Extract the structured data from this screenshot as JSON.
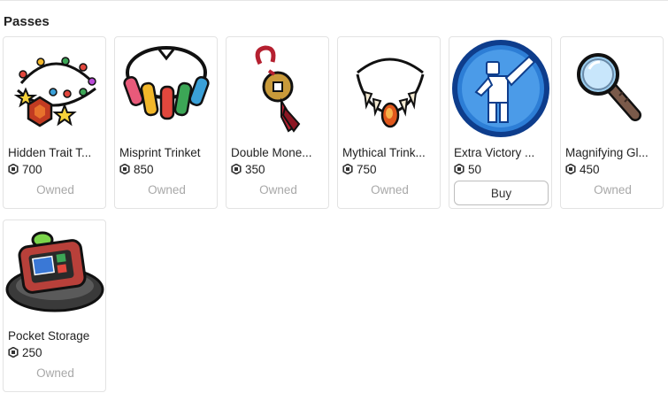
{
  "section": {
    "title": "Passes"
  },
  "currency_icon": "robux-icon",
  "items": [
    {
      "name": "Hidden Trait T...",
      "price": "700",
      "status": "Owned",
      "icon": "charm-bracelet-icon"
    },
    {
      "name": "Misprint Trinket",
      "price": "850",
      "status": "Owned",
      "icon": "vial-necklace-icon"
    },
    {
      "name": "Double Mone...",
      "price": "350",
      "status": "Owned",
      "icon": "coin-charm-icon"
    },
    {
      "name": "Mythical Trink...",
      "price": "750",
      "status": "Owned",
      "icon": "fang-necklace-icon"
    },
    {
      "name": "Extra Victory ...",
      "price": "50",
      "button": "Buy",
      "icon": "victory-pose-icon"
    },
    {
      "name": "Magnifying Gl...",
      "price": "450",
      "status": "Owned",
      "icon": "magnifying-glass-icon"
    },
    {
      "name": "Pocket Storage",
      "price": "250",
      "status": "Owned",
      "icon": "storage-device-icon"
    }
  ]
}
